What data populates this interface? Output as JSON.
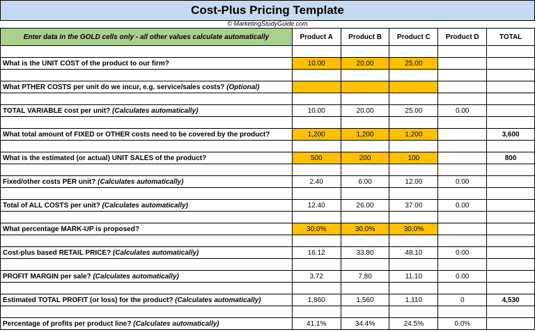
{
  "title": "Cost-Plus Pricing Template",
  "copyright": "© MarketingStudyGuide.com",
  "instruction": "Enter data in the GOLD cells only - all other values calculate automatically",
  "headers": [
    "Product A",
    "Product B",
    "Product C",
    "Product D",
    "TOTAL"
  ],
  "colors": {
    "gold": "#ffc000",
    "green": "#a9d08e",
    "title_bg": "#c5d9f1"
  },
  "rows": [
    {
      "label": "What is the UNIT COST of the product to our firm?",
      "note": "",
      "values": [
        "10.00",
        "20.00",
        "25.00",
        ""
      ],
      "gold": true,
      "total": ""
    },
    {
      "label": "What PTHER COSTS per unit do we incur, e.g. service/sales costs?",
      "note": "(Optional)",
      "values": [
        "",
        "",
        "",
        ""
      ],
      "gold": true,
      "total": ""
    },
    {
      "label": "TOTAL VARIABLE cost per unit?",
      "note": "(Calculates automatically)",
      "values": [
        "10.00",
        "20.00",
        "25.00",
        "0.00"
      ],
      "gold": false,
      "total": ""
    },
    {
      "label": "What total amount of FIXED or OTHER costs need to be covered by the product?",
      "note": "",
      "values": [
        "1,200",
        "1,200",
        "1,200",
        ""
      ],
      "gold": true,
      "total": "3,600"
    },
    {
      "label": "What is the estimated (or actual) UNIT SALES of the product?",
      "note": "",
      "values": [
        "500",
        "200",
        "100",
        ""
      ],
      "gold": true,
      "total": "800"
    },
    {
      "label": "Fixed/other costs PER unit?",
      "note": "(Calculates automatically)",
      "values": [
        "2.40",
        "6.00",
        "12.00",
        "0.00"
      ],
      "gold": false,
      "total": ""
    },
    {
      "label": "Total of ALL COSTS per unit?",
      "note": "(Calculates automatically)",
      "values": [
        "12.40",
        "26.00",
        "37.00",
        "0.00"
      ],
      "gold": false,
      "total": ""
    },
    {
      "label": "What percentage MARK-UP is proposed?",
      "note": "",
      "values": [
        "30.0%",
        "30.0%",
        "30.0%",
        ""
      ],
      "gold": true,
      "total": ""
    },
    {
      "label": "Cost-plus based RETAIL PRICE?",
      "note": "(Calculates automatically)",
      "values": [
        "16.12",
        "33.80",
        "48.10",
        "0.00"
      ],
      "gold": false,
      "total": ""
    },
    {
      "label": "PROFIT MARGIN per sale?",
      "note": "(Calculates automatically)",
      "values": [
        "3.72",
        "7.80",
        "11.10",
        "0.00"
      ],
      "gold": false,
      "total": ""
    },
    {
      "label": "Estimated TOTAL PROFIT (or loss) for the product?",
      "note": "(Calculates automatically)",
      "values": [
        "1,860",
        "1,560",
        "1,110",
        "0"
      ],
      "gold": false,
      "total": "4,530"
    },
    {
      "label": "Percentage of profits per product line?",
      "note": "(Calculates automatically)",
      "values": [
        "41.1%",
        "34.4%",
        "24.5%",
        "0.0%"
      ],
      "gold": false,
      "total": ""
    }
  ]
}
